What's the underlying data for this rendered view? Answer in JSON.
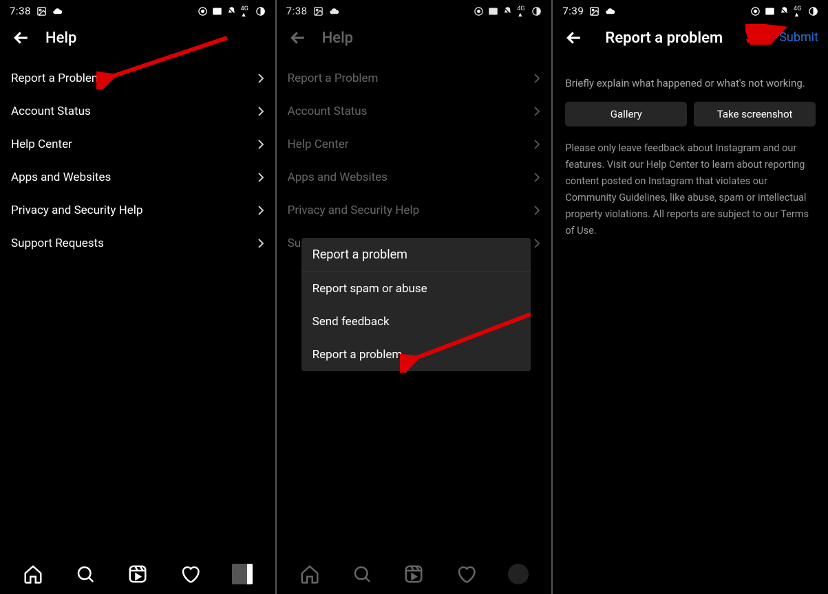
{
  "screens": [
    {
      "status_time": "7:38",
      "header": {
        "title": "Help"
      },
      "items": [
        {
          "label": "Report a Problem"
        },
        {
          "label": "Account Status"
        },
        {
          "label": "Help Center"
        },
        {
          "label": "Apps and Websites"
        },
        {
          "label": "Privacy and Security Help"
        },
        {
          "label": "Support Requests"
        }
      ]
    },
    {
      "status_time": "7:38",
      "header": {
        "title": "Help"
      },
      "items": [
        {
          "label": "Report a Problem"
        },
        {
          "label": "Account Status"
        },
        {
          "label": "Help Center"
        },
        {
          "label": "Apps and Websites"
        },
        {
          "label": "Privacy and Security Help"
        },
        {
          "label": "Su"
        }
      ],
      "dialog": {
        "title": "Report a problem",
        "options": [
          {
            "label": "Report spam or abuse"
          },
          {
            "label": "Send feedback"
          },
          {
            "label": "Report a problem"
          }
        ]
      }
    },
    {
      "status_time": "7:39",
      "header": {
        "title": "Report a problem",
        "submit_label": "Submit"
      },
      "instruction": "Briefly explain what happened or what's not working.",
      "buttons": {
        "gallery": "Gallery",
        "screenshot": "Take screenshot"
      },
      "disclaimer": "Please only leave feedback about Instagram and our features. Visit our Help Center to learn about reporting content posted on Instagram that violates our Community Guidelines, like abuse, spam or intellectual property violations. All reports are subject to our Terms of Use."
    }
  ],
  "nav_icons": [
    "home",
    "search",
    "reels",
    "heart",
    "profile"
  ]
}
